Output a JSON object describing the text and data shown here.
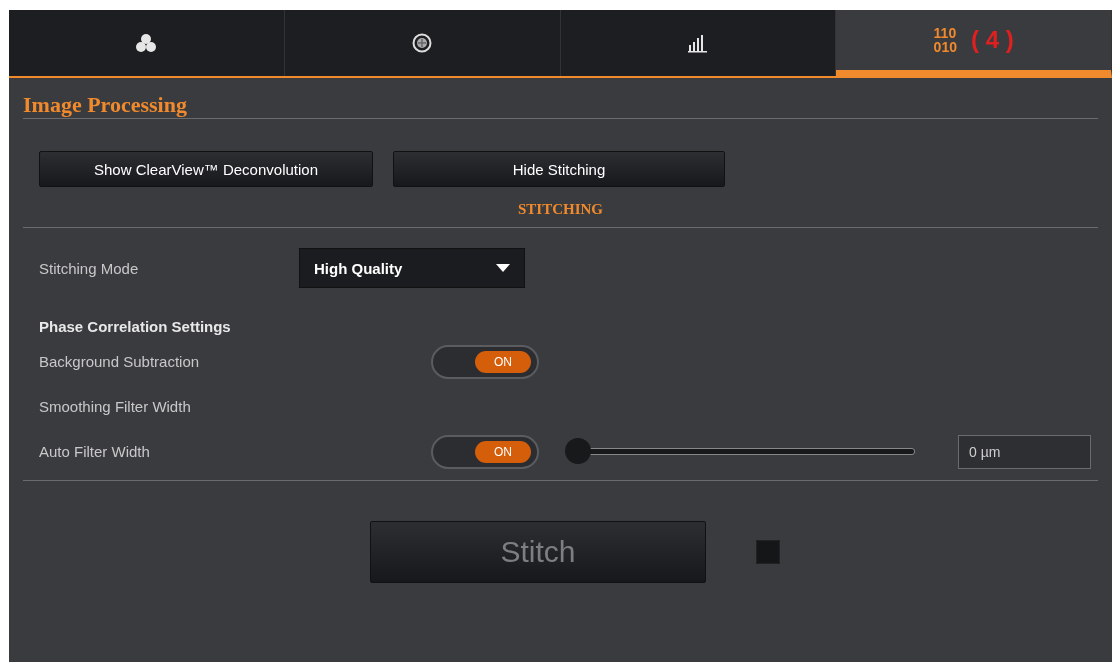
{
  "tabs": [
    {
      "kind": "circles",
      "selected": false
    },
    {
      "kind": "dial",
      "selected": false
    },
    {
      "kind": "bars",
      "selected": false
    },
    {
      "kind": "binary",
      "code_lines": [
        "110",
        "010"
      ],
      "count": "( 4 )",
      "selected": true
    }
  ],
  "title": "Image Processing",
  "buttons": [
    {
      "label": "Show ClearView™ Deconvolution"
    },
    {
      "label": "Hide Stitching"
    }
  ],
  "section": "STITCHING",
  "stitching_mode": {
    "label": "Stitching Mode",
    "value": "High Quality"
  },
  "subheading": "Phase Correlation Settings",
  "settings": [
    {
      "kind": "toggle",
      "label": "Background Subtraction",
      "on": true,
      "toggle_text": "ON"
    },
    {
      "kind": "label",
      "label": "Smoothing Filter Width"
    },
    {
      "kind": "toggle-slider",
      "label": "Auto Filter Width",
      "on": true,
      "toggle_text": "ON",
      "level": 0,
      "value": "0 µm"
    }
  ],
  "stitch_button": {
    "label": "Stitch",
    "disabled": true
  }
}
